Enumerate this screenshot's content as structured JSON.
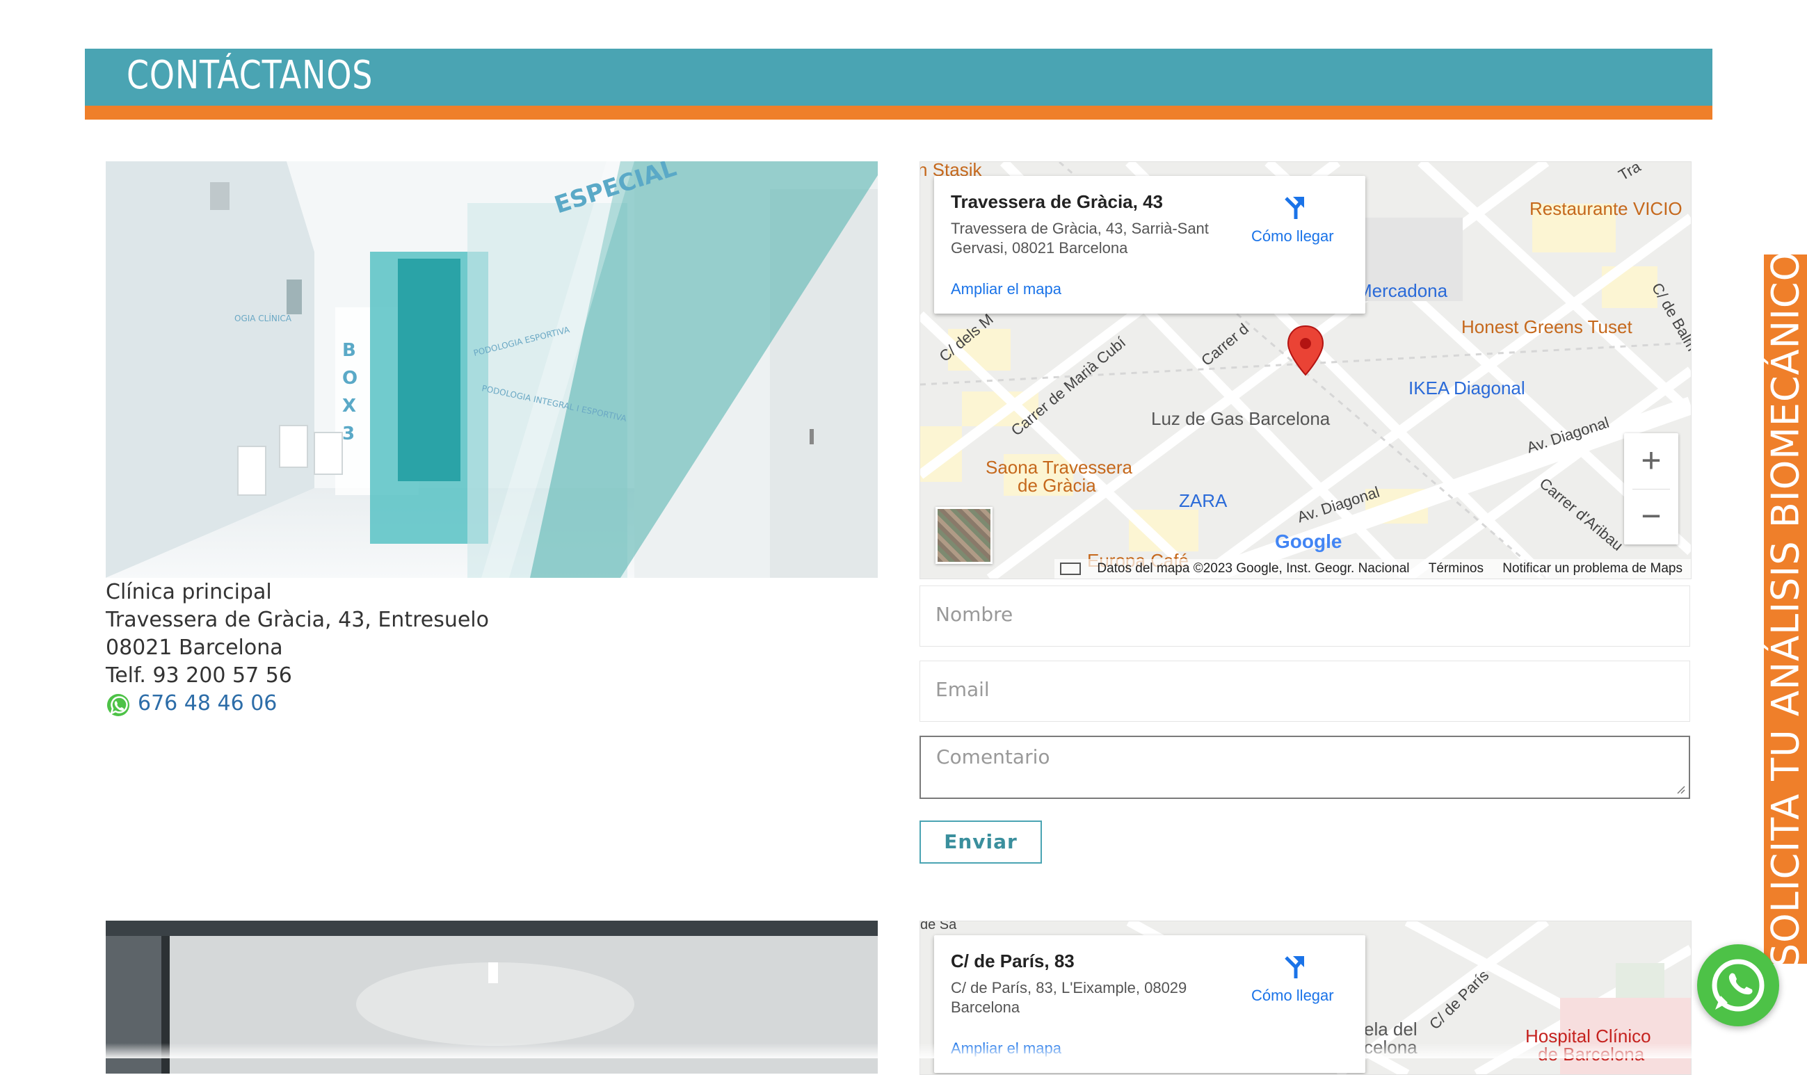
{
  "header": {
    "title": "CONTÁCTANOS"
  },
  "clinic1": {
    "name": "Clínica principal",
    "address_line1": "Travessera de Gràcia, 43, Entresuelo",
    "address_line2": "08021 Barcelona",
    "phone": "Telf. 93 200 57 56",
    "whatsapp": "676 48 46 06",
    "photo_text": {
      "box": "B\nO\nX\n3",
      "especial": "ESPECIAL"
    }
  },
  "map1": {
    "title": "Travessera de Gràcia, 43",
    "address": "Travessera de Gràcia, 43, Sarrià-Sant Gervasi, 08021 Barcelona",
    "directions": "Cómo llegar",
    "expand": "Ampliar el mapa",
    "zoom_in": "+",
    "zoom_out": "−",
    "attribution": "Datos del mapa ©2023 Google, Inst. Geogr. Nacional",
    "terms": "Términos",
    "report": "Notificar un problema de Maps",
    "google": "Google",
    "labels": {
      "stasik": "n Stasik",
      "vicio": "Restaurante VICIO",
      "mercadona": "Mercadona",
      "honest": "Honest Greens Tuset",
      "ikea": "IKEA Diagonal",
      "luz": "Luz de Gas Barcelona",
      "saona1": "Saona Travessera",
      "saona2": "de Gràcia",
      "zara": "ZARA",
      "europa": "Europa Café",
      "diag1": "Av. Diagonal",
      "diag2": "Av. Diagonal",
      "maria": "Carrer de Marià Cubí",
      "dels": "C/ dels M",
      "carrer": "Carrer d",
      "aribau": "Carrer d'Aribau",
      "balm": "C/ de Balm",
      "tra": "Tra"
    }
  },
  "form": {
    "name_placeholder": "Nombre",
    "email_placeholder": "Email",
    "comment_placeholder": "Comentario",
    "submit": "Enviar"
  },
  "map2": {
    "title": "C/ de París, 83",
    "address": "C/ de París, 83, L'Eixample, 08029 Barcelona",
    "directions": "Cómo llegar",
    "expand": "Ampliar el mapa",
    "labels": {
      "paris": "C/ de París",
      "hospital1": "Hospital Clínico",
      "hospital2": "de Barcelona",
      "vila1": "ela del",
      "vila2": "celona",
      "de": "de Sa"
    }
  },
  "side_tab": {
    "text": "SOLICITA TU ANÁLISIS BIOMECÁNICO"
  },
  "colors": {
    "teal": "#4aa4b3",
    "orange": "#ef7f2a",
    "link": "#2d6da8",
    "whatsapp": "#4dc247"
  }
}
